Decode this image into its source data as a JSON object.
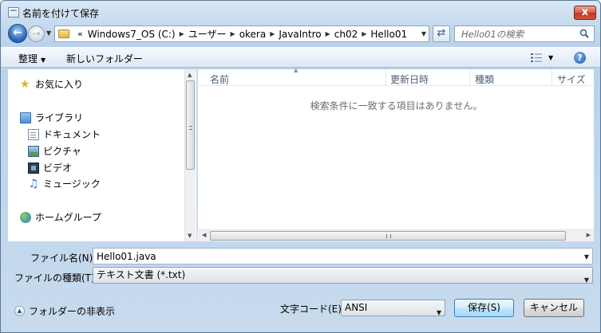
{
  "window": {
    "title": "名前を付けて保存",
    "close_label": "x"
  },
  "address": {
    "overflow": "«",
    "crumbs": [
      "Windows7_OS (C:)",
      "ユーザー",
      "okera",
      "JavaIntro",
      "ch02",
      "Hello01"
    ]
  },
  "search": {
    "placeholder": "Hello01の検索"
  },
  "toolbar": {
    "organize": "整理",
    "new_folder": "新しいフォルダー"
  },
  "nav": {
    "favorites": "お気に入り",
    "libraries": "ライブラリ",
    "documents": "ドキュメント",
    "pictures": "ピクチャ",
    "videos": "ビデオ",
    "music": "ミュージック",
    "homegroup": "ホームグループ"
  },
  "columns": {
    "name": "名前",
    "modified": "更新日時",
    "type": "種類",
    "size": "サイズ"
  },
  "empty_message": "検索条件に一致する項目はありません。",
  "form": {
    "filename_label": "ファイル名(N):",
    "filename_value": "Hello01.java",
    "filetype_label": "ファイルの種類(T):",
    "filetype_value": "テキスト文書 (*.txt)",
    "encoding_label": "文字コード(E):",
    "encoding_value": "ANSI",
    "save_label": "保存(S)",
    "cancel_label": "キャンセル",
    "hide_folders_label": "フォルダーの非表示"
  }
}
